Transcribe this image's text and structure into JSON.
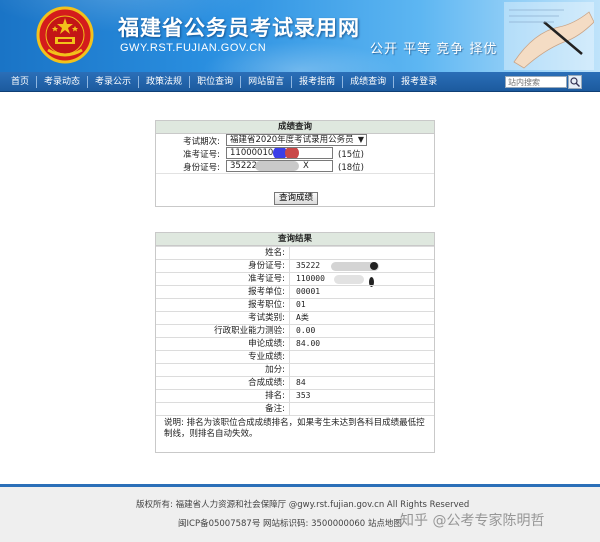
{
  "header": {
    "site_title": "福建省公务员考试录用网",
    "site_domain": "GWY.RST.FUJIAN.GOV.CN",
    "slogan": "公开 平等 竞争 择优"
  },
  "nav": {
    "items": [
      {
        "label": "首页"
      },
      {
        "label": "考录动态"
      },
      {
        "label": "考录公示"
      },
      {
        "label": "政策法规"
      },
      {
        "label": "职位查询"
      },
      {
        "label": "网站留言"
      },
      {
        "label": "报考指南"
      },
      {
        "label": "成绩查询"
      },
      {
        "label": "报考登录"
      }
    ],
    "search_placeholder": "站内搜索"
  },
  "query_form": {
    "title": "成绩查询",
    "exam_period_label": "考试期次:",
    "exam_period_value": "福建省2020年度考试录用公务员",
    "ticket_label": "准考证号:",
    "ticket_value": "11000010",
    "ticket_note": "(15位)",
    "id_label": "身份证号:",
    "id_value_prefix": "35222",
    "id_value_suffix": "X",
    "id_note": "(18位)",
    "submit_label": "查询成绩"
  },
  "result": {
    "title": "查询结果",
    "rows": [
      {
        "label": "姓名:",
        "value": ""
      },
      {
        "label": "身份证号:",
        "value": "35222"
      },
      {
        "label": "准考证号:",
        "value": "110000"
      },
      {
        "label": "报考单位:",
        "value": "00001"
      },
      {
        "label": "报考职位:",
        "value": "01"
      },
      {
        "label": "考试类别:",
        "value": "A类"
      },
      {
        "label": "行政职业能力测验:",
        "value": "0.00"
      },
      {
        "label": "申论成绩:",
        "value": "84.00"
      },
      {
        "label": "专业成绩:",
        "value": ""
      },
      {
        "label": "加分:",
        "value": ""
      },
      {
        "label": "合成成绩:",
        "value": "84"
      },
      {
        "label": "排名:",
        "value": "353"
      },
      {
        "label": "备注:",
        "value": ""
      }
    ],
    "note": "说明: 排名为该职位合成成绩排名，如果考生未达到各科目成绩最低控制线，则排名自动失效。"
  },
  "footer": {
    "copyright": "版权所有: 福建省人力资源和社会保障厅 @gwy.rst.fujian.gov.cn All Rights Reserved",
    "icp": "闽ICP备05007587号  网站标识码: 3500000060 站点地图",
    "watermark": "知乎 @公考专家陈明哲"
  },
  "colors": {
    "nav_bg": "#1c5a9e",
    "panel_title_bg": "#dfe8df",
    "banner_blue": "#2a8fe0"
  }
}
